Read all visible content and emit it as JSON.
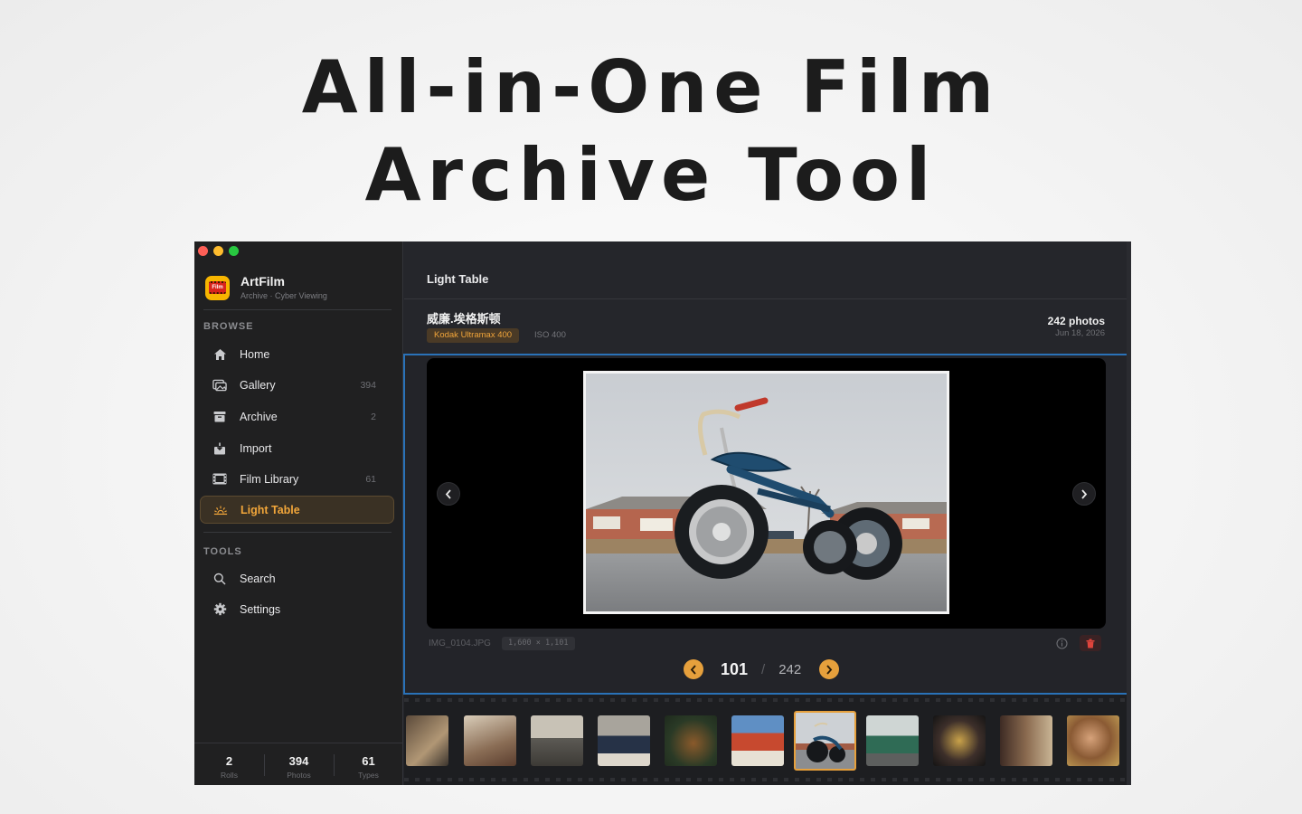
{
  "headline": {
    "line1": "All-in-One Film",
    "line2": "Archive Tool"
  },
  "app": {
    "name": "ArtFilm",
    "subtitle": "Archive · Cyber Viewing",
    "icon_text": "Film"
  },
  "sidebar": {
    "browse_title": "BROWSE",
    "tools_title": "TOOLS",
    "browse_items": [
      {
        "label": "Home",
        "icon": "house-icon",
        "count": ""
      },
      {
        "label": "Gallery",
        "icon": "photos-icon",
        "count": "394"
      },
      {
        "label": "Archive",
        "icon": "archive-box-icon",
        "count": "2"
      },
      {
        "label": "Import",
        "icon": "import-tray-icon",
        "count": ""
      },
      {
        "label": "Film Library",
        "icon": "film-strip-icon",
        "count": "61"
      },
      {
        "label": "Light Table",
        "icon": "light-table-icon",
        "count": "",
        "active": true
      }
    ],
    "tools_items": [
      {
        "label": "Search",
        "icon": "search-icon"
      },
      {
        "label": "Settings",
        "icon": "gear-icon"
      }
    ],
    "stats": [
      {
        "value": "2",
        "label": "Rolls"
      },
      {
        "value": "394",
        "label": "Photos"
      },
      {
        "value": "61",
        "label": "Types"
      }
    ]
  },
  "main": {
    "title": "Light Table",
    "roll": {
      "name": "威廉.埃格斯顿",
      "film_stock": "Kodak Ultramax 400",
      "iso": "ISO 400",
      "photo_count": "242 photos",
      "date": "Jun 18, 2026"
    },
    "viewer": {
      "file_name": "IMG_0104.JPG",
      "dimensions": "1,600 × 1,101",
      "current_page": "101",
      "separator": "/",
      "total_pages": "242"
    }
  },
  "colors": {
    "accent": "#e6a03c",
    "selection_border": "#2a72b8",
    "sidebar_bg": "#202021",
    "main_bg": "#25262b",
    "delete_red": "#e0443c"
  }
}
